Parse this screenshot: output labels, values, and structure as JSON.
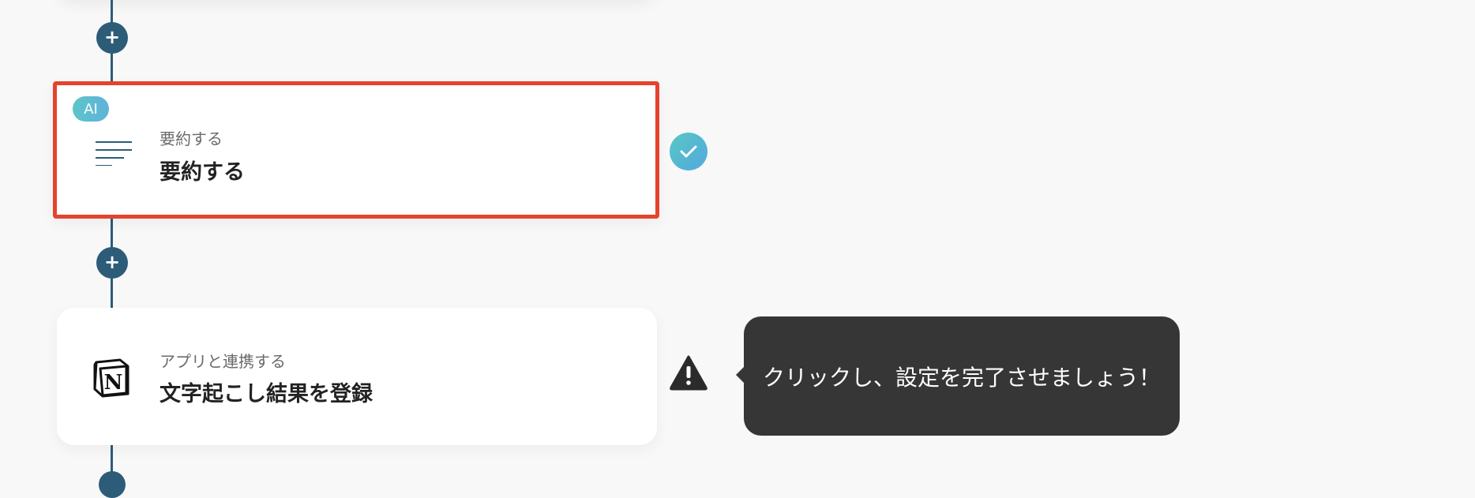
{
  "steps": [
    {
      "badge": "AI",
      "icon": "summary-lines-icon",
      "subtitle": "要約する",
      "title": "要約する",
      "status": "check-icon",
      "highlighted": true
    },
    {
      "icon": "notion-logo-icon",
      "subtitle": "アプリと連携する",
      "title": "文字起こし結果を登録",
      "status": "warning-icon"
    }
  ],
  "tooltip": {
    "text": "クリックし、設定を完了させましょう！"
  },
  "add_button": {
    "symbol": "+"
  },
  "colors": {
    "flow_line": "#2c5c78",
    "highlight_border": "#e5432c",
    "tooltip_bg": "#363636",
    "ai_badge": "#5cc5c9"
  }
}
